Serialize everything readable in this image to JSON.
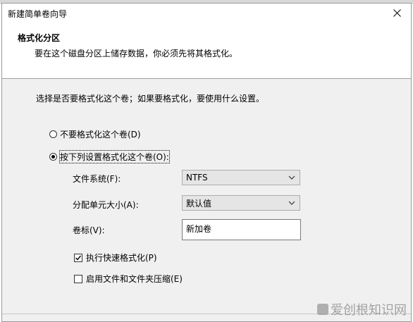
{
  "window": {
    "title": "新建简单卷向导"
  },
  "header": {
    "title": "格式化分区",
    "subtitle": "要在这个磁盘分区上储存数据，你必须先将其格式化。"
  },
  "prompt": "选择是否要格式化这个卷；如果要格式化，要使用什么设置。",
  "options": {
    "no_format": {
      "label": "不要格式化这个卷(D)",
      "checked": false
    },
    "format": {
      "label": "按下列设置格式化这个卷(O):",
      "checked": true
    }
  },
  "fields": {
    "filesystem": {
      "label": "文件系统(F):",
      "value": "NTFS"
    },
    "alloc_size": {
      "label": "分配单元大小(A):",
      "value": "默认值"
    },
    "volume_label": {
      "label": "卷标(V):",
      "value": "新加卷"
    }
  },
  "checks": {
    "quick_format": {
      "label": "执行快速格式化(P)",
      "checked": true
    },
    "compression": {
      "label": "启用文件和文件夹压缩(E)",
      "checked": false
    }
  },
  "watermark": {
    "text": "爱创根知识网"
  }
}
